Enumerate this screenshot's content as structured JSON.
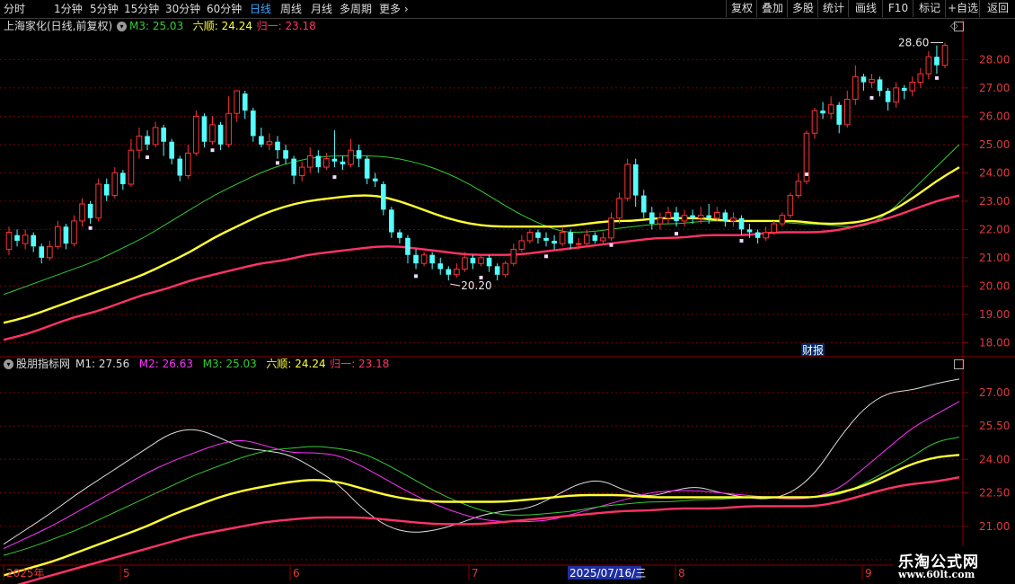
{
  "toolbar": {
    "periods": [
      "分时",
      "1分钟",
      "5分钟",
      "15分钟",
      "30分钟",
      "60分钟",
      "日线",
      "周线",
      "月线",
      "多周期",
      "更多"
    ],
    "active": "日线",
    "right_buttons": [
      "复权",
      "叠加",
      "多股",
      "统计",
      "画线",
      "F10",
      "标记",
      "+自选",
      "返回"
    ]
  },
  "main_panel": {
    "title": "上海家化(日线,前复权)",
    "legend": [
      {
        "text": "M3: 25.03",
        "color": "#33cc33"
      },
      {
        "text": "六顺: 24.24",
        "color": "#ffff33"
      },
      {
        "text": "归一: 23.18",
        "color": "#ff3366"
      }
    ],
    "high_label": "28.60",
    "low_label": "20.20",
    "event_badge": "财报"
  },
  "indicator_panel": {
    "title": "股朋指标网",
    "legend": [
      {
        "text": "M1: 27.56",
        "color": "#dddddd"
      },
      {
        "text": "M2: 26.63",
        "color": "#ff33ff"
      },
      {
        "text": "M3: 25.03",
        "color": "#33cc33"
      },
      {
        "text": "六顺: 24.24",
        "color": "#ffff33"
      },
      {
        "text": "归一: 23.18",
        "color": "#ff3366"
      }
    ]
  },
  "x_axis": {
    "labels": [
      "2025年",
      "5",
      "6",
      "7",
      "8",
      "9"
    ],
    "cursor_date": "2025/07/16/三"
  },
  "watermark": {
    "line1": "乐淘公式网",
    "line2": "www.60lt.com"
  },
  "colors": {
    "up": "#ff3232",
    "down": "#54ffff",
    "m1": "#dddddd",
    "m2": "#ff33ff",
    "m3": "#33cc33",
    "liushun": "#ffff33",
    "guiyi": "#ff3366",
    "grid": "#7a0000"
  },
  "chart_data": [
    {
      "type": "candlestick",
      "title": "上海家化(日线,前复权)",
      "ylim": [
        17.6,
        28.9
      ],
      "y_ticks": [
        18.0,
        19.0,
        20.0,
        21.0,
        22.0,
        23.0,
        24.0,
        25.0,
        26.0,
        27.0,
        28.0
      ],
      "x_labels": [
        "2025年",
        "5",
        "6",
        "7",
        "8",
        "9"
      ],
      "candles": [
        [
          21.3,
          21.9,
          21.1,
          22.1
        ],
        [
          21.8,
          21.6,
          21.4,
          22.0
        ],
        [
          21.5,
          21.8,
          21.3,
          22.0
        ],
        [
          21.8,
          21.4,
          21.2,
          21.9
        ],
        [
          21.4,
          21.0,
          20.8,
          21.5
        ],
        [
          21.0,
          21.4,
          20.9,
          21.6
        ],
        [
          21.4,
          22.1,
          21.3,
          22.3
        ],
        [
          22.1,
          21.5,
          21.3,
          22.2
        ],
        [
          21.5,
          22.3,
          21.4,
          22.5
        ],
        [
          22.3,
          22.9,
          22.1,
          23.1
        ],
        [
          22.9,
          22.4,
          22.2,
          23.0
        ],
        [
          22.4,
          23.6,
          22.3,
          23.8
        ],
        [
          23.6,
          23.2,
          23.0,
          23.8
        ],
        [
          23.2,
          24.0,
          23.1,
          24.2
        ],
        [
          24.0,
          23.6,
          23.4,
          24.1
        ],
        [
          23.6,
          24.8,
          23.5,
          25.2
        ],
        [
          24.8,
          25.3,
          24.5,
          25.6
        ],
        [
          25.3,
          25.0,
          24.8,
          25.5
        ],
        [
          25.0,
          25.6,
          24.9,
          25.8
        ],
        [
          25.6,
          25.1,
          24.6,
          25.7
        ],
        [
          25.1,
          24.5,
          24.3,
          25.2
        ],
        [
          24.5,
          23.9,
          23.7,
          24.6
        ],
        [
          23.9,
          24.7,
          23.8,
          25.0
        ],
        [
          24.7,
          26.0,
          24.6,
          26.2
        ],
        [
          26.0,
          25.1,
          24.9,
          26.1
        ],
        [
          25.1,
          25.7,
          25.0,
          26.0
        ],
        [
          25.7,
          25.0,
          24.8,
          25.8
        ],
        [
          25.0,
          26.1,
          24.9,
          26.7
        ],
        [
          26.1,
          26.9,
          25.8,
          26.9
        ],
        [
          26.8,
          26.2,
          25.9,
          26.9
        ],
        [
          26.2,
          25.3,
          25.1,
          26.3
        ],
        [
          25.3,
          25.0,
          24.9,
          25.6
        ],
        [
          25.0,
          25.1,
          24.8,
          25.4
        ],
        [
          25.1,
          24.8,
          24.5,
          25.3
        ],
        [
          24.8,
          24.5,
          24.3,
          25.0
        ],
        [
          24.5,
          23.9,
          23.6,
          24.6
        ],
        [
          23.9,
          24.2,
          23.7,
          24.4
        ],
        [
          24.2,
          24.6,
          24.0,
          24.9
        ],
        [
          24.6,
          24.2,
          24.0,
          24.8
        ],
        [
          24.2,
          24.5,
          24.1,
          24.7
        ],
        [
          24.5,
          24.4,
          24.2,
          25.5
        ],
        [
          24.4,
          24.3,
          24.1,
          24.6
        ],
        [
          24.3,
          24.8,
          24.2,
          25.2
        ],
        [
          24.8,
          24.5,
          24.2,
          25.0
        ],
        [
          24.5,
          23.8,
          23.6,
          24.6
        ],
        [
          23.8,
          23.7,
          23.5,
          24.0
        ],
        [
          23.6,
          22.7,
          22.5,
          23.7
        ],
        [
          22.7,
          21.9,
          21.7,
          22.8
        ],
        [
          21.9,
          21.7,
          21.5,
          22.0
        ],
        [
          21.7,
          21.1,
          20.8,
          21.8
        ],
        [
          21.1,
          20.8,
          20.6,
          21.3
        ],
        [
          20.8,
          21.1,
          20.7,
          21.2
        ],
        [
          21.1,
          20.8,
          20.6,
          21.2
        ],
        [
          20.8,
          20.6,
          20.4,
          21.0
        ],
        [
          20.6,
          20.4,
          20.2,
          20.7
        ],
        [
          20.4,
          20.6,
          20.3,
          20.8
        ],
        [
          20.6,
          21.0,
          20.5,
          21.2
        ],
        [
          21.0,
          20.8,
          20.6,
          21.1
        ],
        [
          20.8,
          21.0,
          20.7,
          21.1
        ],
        [
          21.0,
          20.7,
          20.5,
          21.1
        ],
        [
          20.7,
          20.4,
          20.2,
          20.8
        ],
        [
          20.4,
          20.8,
          20.3,
          20.9
        ],
        [
          20.8,
          21.3,
          20.7,
          21.5
        ],
        [
          21.3,
          21.6,
          21.2,
          21.8
        ],
        [
          21.6,
          21.9,
          21.5,
          22.0
        ],
        [
          21.9,
          21.7,
          21.5,
          22.0
        ],
        [
          21.7,
          21.6,
          21.4,
          21.9
        ],
        [
          21.6,
          21.5,
          21.3,
          21.8
        ],
        [
          21.5,
          21.9,
          21.4,
          22.1
        ],
        [
          21.9,
          21.5,
          21.3,
          22.0
        ],
        [
          21.5,
          21.5,
          21.3,
          21.7
        ],
        [
          21.5,
          21.8,
          21.4,
          22.0
        ],
        [
          21.8,
          21.6,
          21.5,
          21.9
        ],
        [
          21.6,
          21.7,
          21.5,
          21.9
        ],
        [
          21.7,
          22.4,
          21.6,
          22.6
        ],
        [
          22.4,
          23.1,
          22.2,
          23.3
        ],
        [
          23.1,
          24.3,
          23.0,
          24.5
        ],
        [
          24.3,
          23.2,
          22.8,
          24.5
        ],
        [
          23.2,
          22.6,
          22.4,
          23.4
        ],
        [
          22.6,
          22.2,
          22.0,
          22.8
        ],
        [
          22.2,
          22.4,
          22.0,
          22.6
        ],
        [
          22.4,
          22.6,
          22.2,
          22.8
        ],
        [
          22.6,
          22.3,
          22.1,
          22.8
        ],
        [
          22.3,
          22.5,
          22.1,
          22.7
        ],
        [
          22.5,
          22.4,
          22.2,
          22.7
        ],
        [
          22.4,
          22.5,
          22.2,
          22.8
        ],
        [
          22.5,
          22.4,
          22.2,
          22.9
        ],
        [
          22.4,
          22.6,
          22.3,
          22.8
        ],
        [
          22.6,
          22.3,
          22.1,
          22.7
        ],
        [
          22.3,
          22.4,
          22.1,
          22.6
        ],
        [
          22.4,
          22.0,
          21.8,
          22.5
        ],
        [
          22.0,
          21.9,
          21.7,
          22.2
        ],
        [
          21.9,
          21.7,
          21.5,
          22.0
        ],
        [
          21.7,
          21.9,
          21.6,
          22.1
        ],
        [
          21.9,
          22.2,
          21.8,
          22.3
        ],
        [
          22.2,
          22.5,
          22.1,
          22.6
        ],
        [
          22.5,
          23.2,
          22.4,
          23.3
        ],
        [
          23.2,
          23.7,
          23.1,
          24.0
        ],
        [
          23.7,
          25.4,
          23.6,
          25.5
        ],
        [
          25.4,
          26.2,
          25.2,
          26.3
        ],
        [
          26.2,
          26.1,
          25.9,
          26.5
        ],
        [
          26.1,
          26.4,
          25.9,
          26.7
        ],
        [
          26.4,
          25.7,
          25.4,
          26.5
        ],
        [
          25.7,
          26.6,
          25.6,
          26.9
        ],
        [
          26.6,
          27.4,
          26.4,
          27.8
        ],
        [
          27.4,
          27.2,
          26.9,
          27.5
        ],
        [
          27.2,
          27.3,
          27.0,
          27.5
        ],
        [
          27.3,
          26.9,
          26.7,
          27.4
        ],
        [
          26.9,
          26.5,
          26.2,
          27.0
        ],
        [
          26.5,
          27.0,
          26.3,
          27.2
        ],
        [
          27.0,
          26.9,
          26.6,
          27.1
        ],
        [
          26.9,
          27.2,
          26.7,
          27.4
        ],
        [
          27.2,
          27.5,
          27.0,
          27.7
        ],
        [
          27.5,
          28.1,
          27.3,
          28.3
        ],
        [
          28.1,
          27.8,
          27.5,
          28.5
        ],
        [
          27.8,
          28.5,
          27.7,
          28.6
        ]
      ],
      "series": [
        {
          "name": "M3",
          "values": [
            19.7,
            20.0,
            20.3,
            20.6,
            20.9,
            21.3,
            21.7,
            22.2,
            22.7,
            23.2,
            23.6,
            24.0,
            24.3,
            24.5,
            24.6,
            24.6,
            24.6,
            24.5,
            24.3,
            24.0,
            23.6,
            23.1,
            22.6,
            22.2,
            21.9,
            21.9,
            22.0,
            22.1,
            22.2,
            22.2,
            22.3,
            22.3,
            22.3,
            22.3,
            22.2,
            22.2,
            22.1,
            22.1,
            22.6,
            23.4,
            24.2,
            25.0
          ]
        },
        {
          "name": "六顺",
          "values": [
            18.7,
            18.9,
            19.2,
            19.5,
            19.8,
            20.1,
            20.4,
            20.8,
            21.2,
            21.7,
            22.1,
            22.5,
            22.8,
            23.0,
            23.1,
            23.2,
            23.2,
            23.0,
            22.7,
            22.4,
            22.2,
            22.1,
            22.1,
            22.1,
            22.1,
            22.2,
            22.3,
            22.3,
            22.4,
            22.4,
            22.4,
            22.3,
            22.3,
            22.3,
            22.3,
            22.2,
            22.2,
            22.3,
            22.6,
            23.1,
            23.7,
            24.2
          ]
        },
        {
          "name": "归一",
          "values": [
            18.1,
            18.3,
            18.6,
            18.9,
            19.1,
            19.4,
            19.7,
            19.9,
            20.2,
            20.4,
            20.6,
            20.8,
            20.9,
            21.1,
            21.2,
            21.3,
            21.4,
            21.4,
            21.3,
            21.2,
            21.1,
            21.1,
            21.1,
            21.2,
            21.3,
            21.4,
            21.5,
            21.6,
            21.7,
            21.7,
            21.8,
            21.8,
            21.8,
            21.9,
            21.9,
            21.9,
            22.0,
            22.2,
            22.4,
            22.7,
            23.0,
            23.2
          ]
        }
      ]
    },
    {
      "type": "line",
      "title": "股朋指标网",
      "ylim": [
        19.3,
        28.0
      ],
      "y_ticks": [
        19.5,
        21.0,
        22.5,
        24.0,
        25.5,
        27.0
      ],
      "series": [
        {
          "name": "M1",
          "values": [
            20.2,
            20.9,
            21.6,
            22.4,
            23.1,
            23.8,
            24.5,
            25.2,
            25.4,
            25.0,
            24.5,
            24.4,
            24.2,
            23.6,
            22.9,
            21.8,
            21.0,
            20.7,
            20.8,
            21.1,
            21.5,
            21.7,
            21.8,
            22.3,
            22.9,
            23.1,
            22.6,
            22.3,
            22.6,
            22.8,
            22.5,
            22.3,
            22.2,
            22.5,
            23.4,
            25.0,
            26.3,
            27.0,
            27.1,
            27.4,
            27.6
          ]
        },
        {
          "name": "M2",
          "values": [
            20.0,
            20.5,
            21.0,
            21.6,
            22.2,
            22.8,
            23.4,
            23.9,
            24.3,
            24.7,
            24.9,
            24.6,
            24.3,
            24.3,
            24.2,
            23.7,
            23.1,
            22.5,
            22.0,
            21.6,
            21.3,
            21.2,
            21.2,
            21.3,
            21.6,
            21.9,
            22.2,
            22.5,
            22.6,
            22.6,
            22.5,
            22.4,
            22.3,
            22.2,
            22.3,
            22.7,
            23.6,
            24.5,
            25.4,
            26.0,
            26.6
          ]
        },
        {
          "name": "M3",
          "values": [
            19.7,
            20.0,
            20.4,
            20.8,
            21.3,
            21.8,
            22.3,
            22.8,
            23.3,
            23.7,
            24.1,
            24.4,
            24.5,
            24.6,
            24.5,
            24.3,
            23.8,
            23.2,
            22.6,
            22.1,
            21.7,
            21.5,
            21.5,
            21.6,
            21.7,
            21.9,
            22.0,
            22.1,
            22.1,
            22.2,
            22.2,
            22.3,
            22.3,
            22.3,
            22.3,
            22.4,
            22.9,
            23.5,
            24.1,
            24.8,
            25.0
          ]
        },
        {
          "name": "六顺",
          "values": [
            18.8,
            19.1,
            19.4,
            19.8,
            20.2,
            20.6,
            21.0,
            21.5,
            21.9,
            22.3,
            22.6,
            22.8,
            23.0,
            23.1,
            23.0,
            22.7,
            22.4,
            22.2,
            22.1,
            22.1,
            22.1,
            22.1,
            22.2,
            22.3,
            22.4,
            22.4,
            22.4,
            22.3,
            22.3,
            22.3,
            22.3,
            22.3,
            22.3,
            22.3,
            22.3,
            22.5,
            22.8,
            23.3,
            23.8,
            24.1,
            24.2
          ]
        },
        {
          "name": "归一",
          "values": [
            18.2,
            18.5,
            18.8,
            19.1,
            19.4,
            19.7,
            20.0,
            20.3,
            20.6,
            20.8,
            21.0,
            21.2,
            21.3,
            21.4,
            21.4,
            21.4,
            21.3,
            21.2,
            21.1,
            21.1,
            21.1,
            21.2,
            21.3,
            21.4,
            21.5,
            21.6,
            21.7,
            21.7,
            21.8,
            21.8,
            21.8,
            21.9,
            21.9,
            21.9,
            21.9,
            22.1,
            22.4,
            22.7,
            22.9,
            23.0,
            23.2
          ]
        }
      ]
    }
  ]
}
